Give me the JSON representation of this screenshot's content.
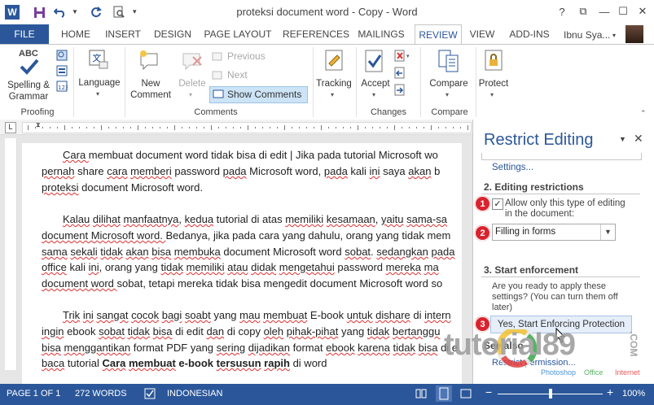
{
  "window": {
    "title": "proteksi document word - Copy - Word",
    "app_logo": "W",
    "icons": [
      "save-icon",
      "undo-icon",
      "redo-icon",
      "print-preview-icon",
      "customize-icon"
    ],
    "controls": {
      "help": "?",
      "restore": "⧉",
      "minimize": "—",
      "maximize": "☐",
      "close": "✕"
    }
  },
  "tabs": [
    "FILE",
    "HOME",
    "INSERT",
    "DESIGN",
    "PAGE LAYOUT",
    "REFERENCES",
    "MAILINGS",
    "REVIEW",
    "VIEW",
    "ADD-INS"
  ],
  "active_tab": "REVIEW",
  "user": {
    "name": "Ibnu Sya..."
  },
  "ribbon": {
    "proofing": {
      "abc": "ABC",
      "spelling": "Spelling &",
      "grammar": "Grammar",
      "label": "Proofing"
    },
    "language": {
      "label": "Language"
    },
    "comments": {
      "new": "New",
      "new2": "Comment",
      "delete": "Delete",
      "previous": "Previous",
      "next": "Next",
      "show": "Show Comments",
      "label": "Comments"
    },
    "tracking": {
      "label": "Tracking"
    },
    "changes": {
      "accept": "Accept",
      "label": "Changes"
    },
    "compare": {
      "compare": "Compare",
      "label": "Compare"
    },
    "protect": {
      "protect": "Protect"
    }
  },
  "document": {
    "lines": [
      [
        "Cara ",
        "membuat",
        " document word ",
        "tidak",
        " ",
        "bisa",
        " di edit | ",
        "Jika",
        " ",
        "pada",
        " tutorial Microsoft wo"
      ],
      [
        "pernah",
        " share ",
        "cara",
        " ",
        "memberi",
        " password ",
        "pada",
        " Microsoft word, ",
        "pada",
        " kali ",
        "ini",
        " saya ",
        "akan",
        " b"
      ],
      [
        "proteksi",
        " document Microsoft word.",
        "",
        "",
        "",
        "",
        "",
        "",
        "",
        "",
        ""
      ],
      [
        "Kalau",
        " ",
        "dilihat",
        " ",
        "manfaatnya",
        ", ",
        "kedua",
        " tutorial di atas ",
        "memiliki",
        " ",
        "kesamaan",
        ", ",
        "yaitu",
        " ",
        "sama-sa"
      ],
      [
        "document Microsoft word. ",
        "Bedanya",
        ", ",
        "jika",
        " ",
        "pada",
        " ",
        "cara",
        " yang ",
        "dahulu",
        ", orang yang ",
        "tidak",
        " ",
        "mem"
      ],
      [
        "sama",
        " ",
        "sekali",
        " ",
        "tidak",
        " ",
        "akan",
        " ",
        "bisa",
        " ",
        "membuka",
        " document Microsoft word ",
        "sobat",
        ". ",
        "sedangkan",
        " ",
        "pada"
      ],
      [
        "office",
        " kali ",
        "ini",
        ", orang yang ",
        "tidak",
        " ",
        "memiliki",
        " ",
        "atau",
        " ",
        "didak",
        " ",
        "mengetahui",
        " password ",
        "mereka",
        " ",
        "ma"
      ],
      [
        "document word ",
        "sobat",
        ", ",
        "tetapi",
        " ",
        "mereka",
        " ",
        "tidak",
        " ",
        "bisa",
        " ",
        "mengedit",
        " document Microsoft word ",
        "so"
      ],
      [
        "Trik",
        " ",
        "ini",
        " ",
        "sangat",
        " ",
        "cocok",
        " ",
        "bagi",
        " ",
        "soabt",
        " yang ",
        "mau",
        " ",
        "membuat",
        " E-book ",
        "untuk",
        " ",
        "dishare",
        " di ",
        "intern"
      ],
      [
        "ingin",
        " ebook ",
        "sobat",
        " ",
        "tidak",
        " ",
        "bisa",
        " di edit ",
        "dan",
        " di copy ",
        "oleh",
        " ",
        "pihak-pihat",
        " yang ",
        "tidak",
        " ",
        "bertanggu"
      ],
      [
        "bisa",
        " ",
        "menggantikan",
        " format PDF yang ",
        "sering",
        " ",
        "dijadikan",
        " format ",
        "ebook",
        " ",
        "karena",
        " ",
        "tidak",
        " ",
        "bisa",
        " di e"
      ],
      [
        "baca",
        " tutorial ",
        "Cara",
        " ",
        "membuat",
        " e-book ",
        "tersusun",
        " ",
        "rapih",
        " di word"
      ]
    ]
  },
  "pane": {
    "title": "Restrict Editing",
    "settings_link": "Settings...",
    "section2": "2. Editing restrictions",
    "checkbox_label_1": "Allow only this type of editing",
    "checkbox_label_2": "in the document:",
    "checkbox_checked": true,
    "dropdown_value": "Filling in forms",
    "section3": "3. Start enforcement",
    "question_1": "Are you ready to apply these",
    "question_2": "settings? (You can turn them off",
    "question_3": "later)",
    "enforce_button": "Yes, Start Enforcing Protection",
    "see_also": "See also",
    "restrict_permission": "Restrict permission...",
    "badges": [
      "1",
      "2",
      "3"
    ]
  },
  "status": {
    "page": "PAGE 1 OF 1",
    "words": "272 WORDS",
    "language": "INDONESIAN",
    "zoom": "100%",
    "zoom_level": 1.0
  },
  "watermark": {
    "text": "tutorial89",
    "sub1": "Photoshop",
    "sub2": "Office",
    "sub3": "Internet",
    "com": ".COM"
  },
  "colors": {
    "accent": "#2b579a",
    "badge": "#d9232e",
    "squiggle": "#e03030"
  }
}
